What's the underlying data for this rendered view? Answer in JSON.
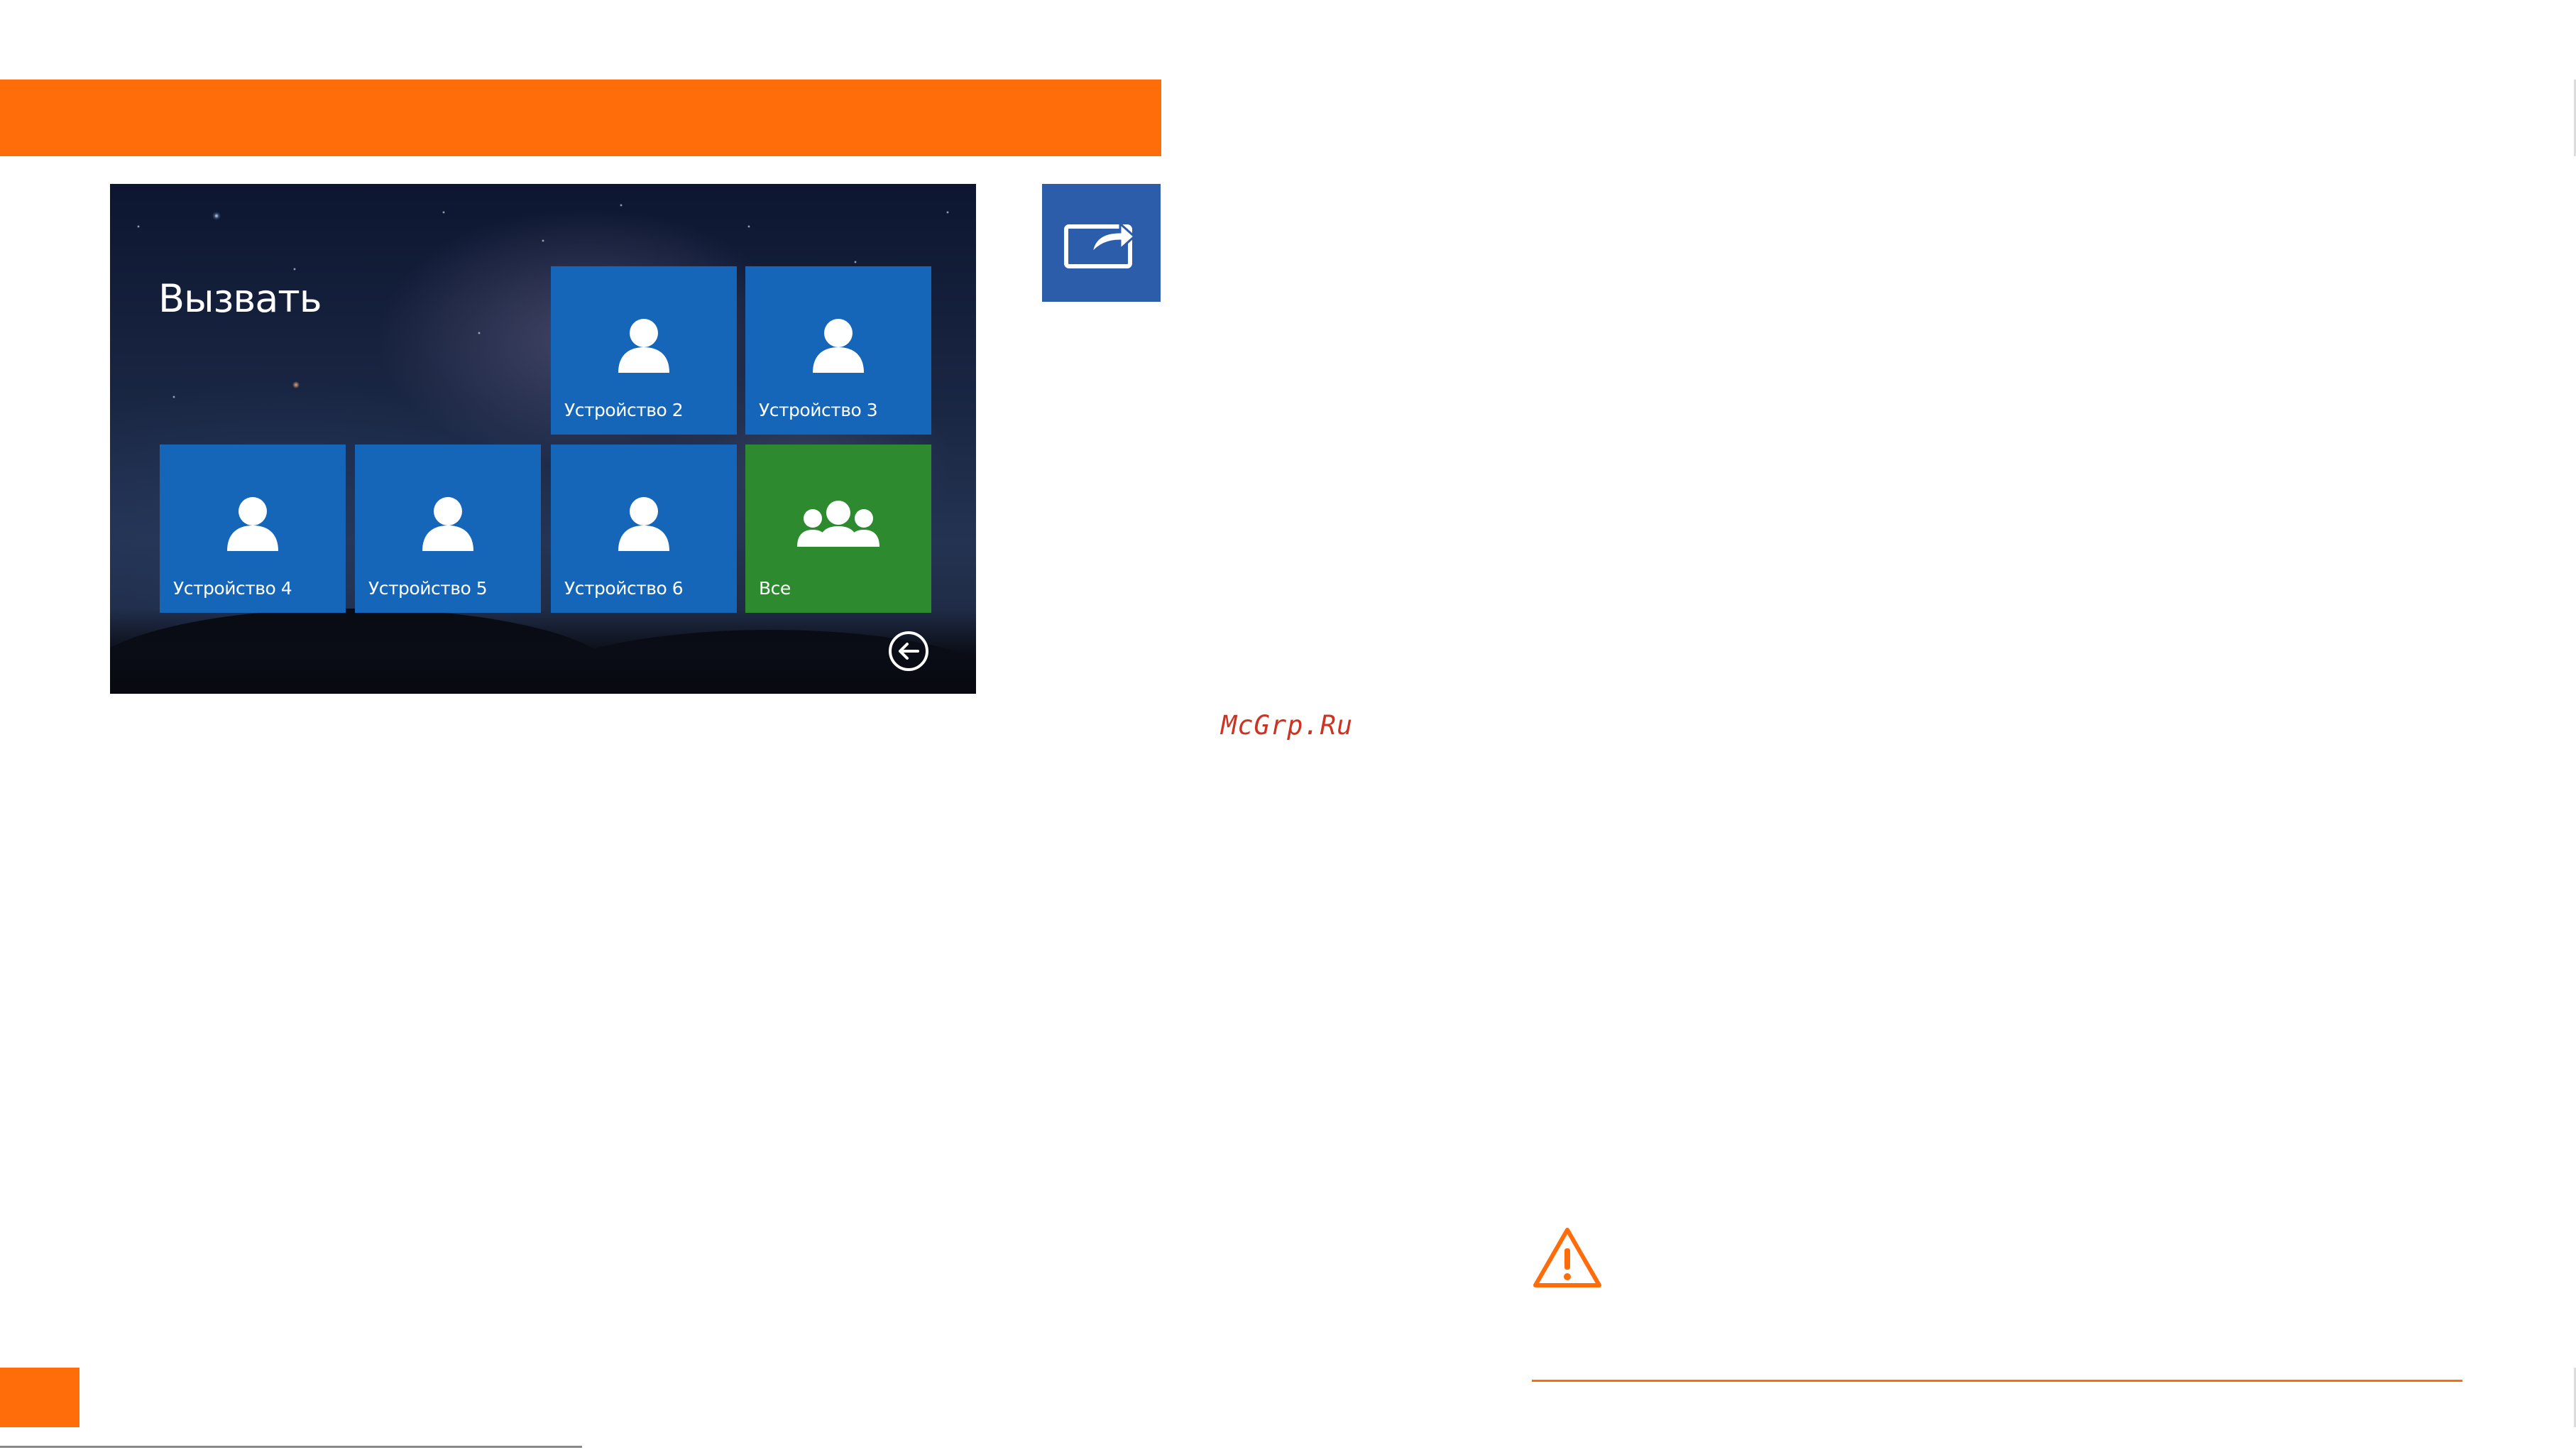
{
  "screen": {
    "title": "Вызвать",
    "tiles": [
      {
        "label": "Устройство 2",
        "icon": "user-icon",
        "color": "#1565b8"
      },
      {
        "label": "Устройство 3",
        "icon": "user-icon",
        "color": "#1565b8"
      },
      {
        "label": "Устройство 4",
        "icon": "user-icon",
        "color": "#1565b8"
      },
      {
        "label": "Устройство 5",
        "icon": "user-icon",
        "color": "#1565b8"
      },
      {
        "label": "Устройство 6",
        "icon": "user-icon",
        "color": "#1565b8"
      },
      {
        "label": "Все",
        "icon": "group-icon",
        "color": "#2e8a2e"
      }
    ],
    "back_icon": "arrow-left-circle-icon"
  },
  "side_button": {
    "icon": "screen-share-icon",
    "color": "#2c5dab"
  },
  "watermark": "McGrp.Ru",
  "warning_icon": "warning-triangle-icon",
  "accent_color": "#ff6d0a"
}
